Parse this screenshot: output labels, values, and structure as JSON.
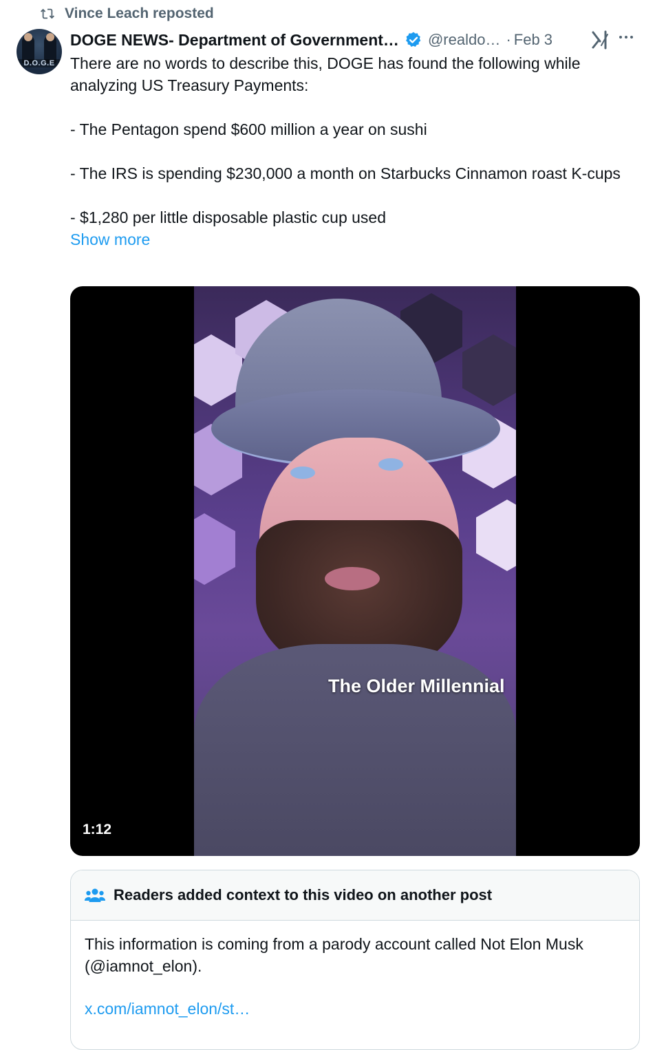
{
  "repost": {
    "icon": "repost-icon",
    "text": "Vince Leach reposted"
  },
  "author": {
    "avatar_label": "D.O.G.E",
    "name": "DOGE NEWS- Department of Government…",
    "verified_icon": "verified-badge-icon",
    "handle": "@realdo…",
    "separator": "·",
    "date": "Feb 3"
  },
  "actions": {
    "grok_icon": "grok-icon",
    "more_icon": "more-icon"
  },
  "tweet": {
    "lines": [
      "There are no words to describe this, DOGE has found the following while analyzing US Treasury Payments:",
      "- The Pentagon spend $600 million a year on sushi",
      "- The IRS is spending $230,000 a month on Starbucks Cinnamon roast K-cups",
      "- $1,280 per little disposable plastic cup used"
    ],
    "show_more": "Show more"
  },
  "media": {
    "duration": "1:12",
    "overlay_text": "The Older Millennial"
  },
  "community_note": {
    "icon": "people-icon",
    "title": "Readers added context to this video on another post",
    "body": "This information is coming from a parody account called Not Elon Musk (@iamnot_elon).",
    "link": "x.com/iamnot_elon/st…"
  },
  "colors": {
    "link": "#1d9bf0",
    "secondary_text": "#536471",
    "primary_text": "#0f1419"
  }
}
